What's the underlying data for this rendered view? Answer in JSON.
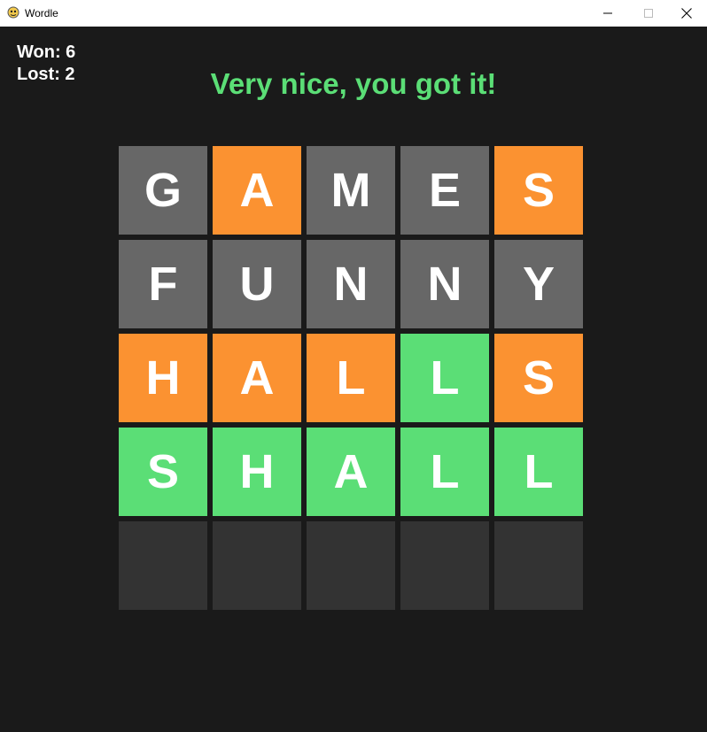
{
  "window": {
    "title": "Wordle"
  },
  "score": {
    "won": "Won: 6",
    "lost": "Lost: 2"
  },
  "message": "Very nice, you got it!",
  "colors": {
    "absent": "#676767",
    "present": "#fb9231",
    "correct": "#5bde76",
    "empty": "#333333",
    "background": "#1a1a1a"
  },
  "board": [
    {
      "letters": [
        "G",
        "A",
        "M",
        "E",
        "S"
      ],
      "states": [
        "absent",
        "present",
        "absent",
        "absent",
        "present"
      ]
    },
    {
      "letters": [
        "F",
        "U",
        "N",
        "N",
        "Y"
      ],
      "states": [
        "absent",
        "absent",
        "absent",
        "absent",
        "absent"
      ]
    },
    {
      "letters": [
        "H",
        "A",
        "L",
        "L",
        "S"
      ],
      "states": [
        "present",
        "present",
        "present",
        "correct",
        "present"
      ]
    },
    {
      "letters": [
        "S",
        "H",
        "A",
        "L",
        "L"
      ],
      "states": [
        "correct",
        "correct",
        "correct",
        "correct",
        "correct"
      ]
    },
    {
      "letters": [
        "",
        "",
        "",
        "",
        ""
      ],
      "states": [
        "empty",
        "empty",
        "empty",
        "empty",
        "empty"
      ]
    }
  ]
}
